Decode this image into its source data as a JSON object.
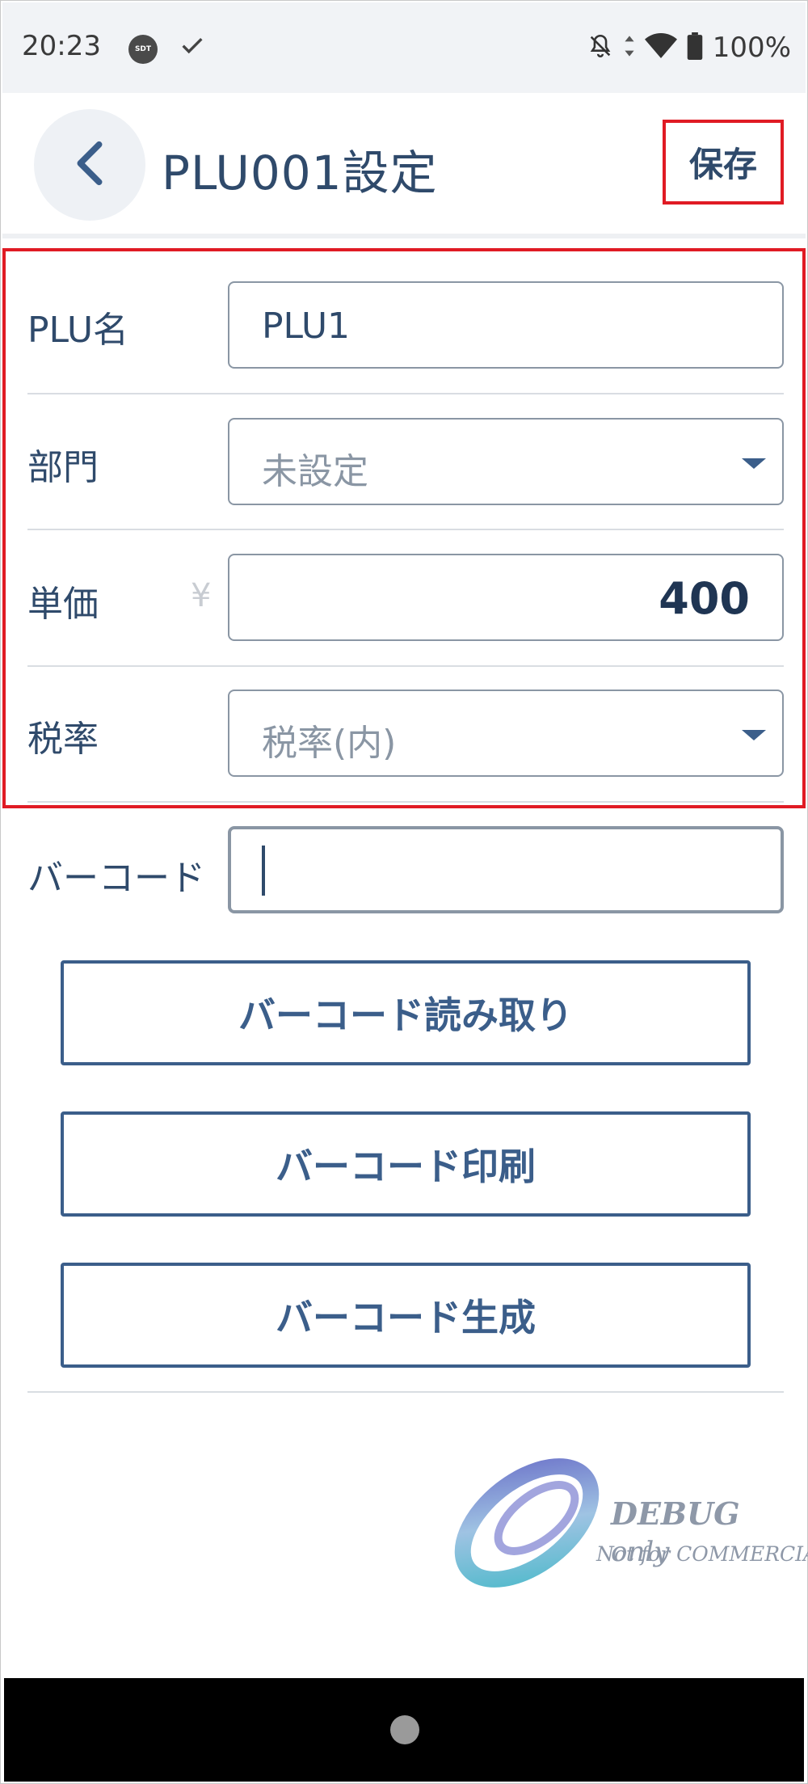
{
  "status_bar": {
    "time": "20:23",
    "sdt_badge": "SDT",
    "battery": "100%"
  },
  "header": {
    "title": "PLU001設定",
    "save_label": "保存"
  },
  "form": {
    "name": {
      "label": "PLU名",
      "value": "PLU1"
    },
    "department": {
      "label": "部門",
      "placeholder": "未設定"
    },
    "price": {
      "label": "単価",
      "currency": "¥",
      "value": "400"
    },
    "tax": {
      "label": "税率",
      "placeholder": "税率(内)"
    },
    "barcode": {
      "label": "バーコード",
      "value": ""
    }
  },
  "actions": {
    "read_barcode": "バーコード読み取り",
    "print_barcode": "バーコード印刷",
    "generate_barcode": "バーコード生成"
  },
  "watermark": {
    "line1": "DEBUG",
    "line1_suffix": "only",
    "line2": "Not for COMMERCIAL"
  },
  "colors": {
    "accent": "#2f4a6b",
    "button_border": "#3b5e8a",
    "highlight": "#e01b24"
  }
}
